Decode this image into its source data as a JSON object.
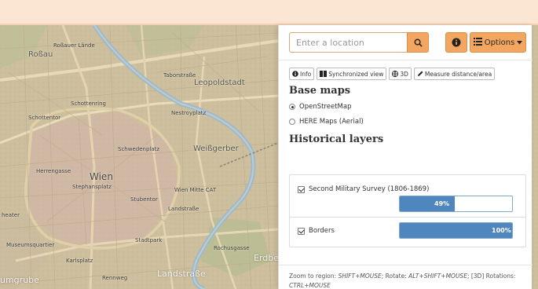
{
  "colors": {
    "accent": "#f2a65f",
    "header": "#fbe6d4",
    "progress_fill": "#4f86bd",
    "map_base": "#cdbf9d",
    "river": "#9fb8c7"
  },
  "icons": {
    "search": "search-icon",
    "info": "info-icon",
    "options": "list-icon",
    "caret": "caret-down-icon",
    "tab_info": "info-circle-icon",
    "tab_sync": "columns-icon",
    "tab_3d": "globe-icon",
    "tab_measure": "pencil-icon"
  },
  "search": {
    "placeholder": "Enter a location"
  },
  "toolbar": {
    "options_label": "Options"
  },
  "tabs": [
    {
      "label": "Info"
    },
    {
      "label": "Synchronized view"
    },
    {
      "label": "3D"
    },
    {
      "label": "Measure distance/area"
    }
  ],
  "base_maps": {
    "title": "Base maps",
    "options": [
      {
        "label": "OpenStreetMap",
        "selected": true
      },
      {
        "label": "HERE Maps (Aerial)",
        "selected": false
      }
    ]
  },
  "historical_layers": {
    "title": "Historical layers",
    "layers": [
      {
        "label": "Second Military Survey (1806-1869)",
        "checked": true,
        "opacity_label": "49%",
        "opacity": 0.49
      },
      {
        "label": "Borders",
        "checked": true,
        "opacity_label": "100%",
        "opacity": 1.0
      }
    ]
  },
  "footer": {
    "prefix": "Zoom to region: ",
    "zoom_keys": "SHIFT+MOUSE",
    "rotate_prefix": "; Rotate: ",
    "rotate_keys": "ALT+SHIFT+MOUSE",
    "rot3d_prefix": "; [3D] Rotations: ",
    "rot3d_keys": "CTRL+MOUSE"
  },
  "map_labels": {
    "rossauer_lande": "Roßauer Lände",
    "rossau": "Roßau",
    "taborstrasse": "Taborstraße",
    "leopoldstadt": "Leopoldstadt",
    "schottenring": "Schottenring",
    "schottentor": "Schottentor",
    "nestroyplatz": "Nestroyplatz",
    "schwedenplatz": "Schwedenplatz",
    "weissgerber": "Weißgerber",
    "herrengasse": "Herrengasse",
    "wien": "Wien",
    "stephansplatz": "Stephansplatz",
    "wien_mitte": "Wien Mitte CAT",
    "stubentor": "Stubentor",
    "landstrasse": "Landstraße",
    "theater": "heater",
    "museumsquartier": "Museumsquartier",
    "karlsplatz": "Karlsplatz",
    "stadtpark": "Stadtpark",
    "rochusgasse": "Rochusgasse",
    "erdberg": "Erdbe",
    "landstrasse2": "Landstraße",
    "rennweg": "Rennweg",
    "gumpendorf": "umgrube"
  }
}
